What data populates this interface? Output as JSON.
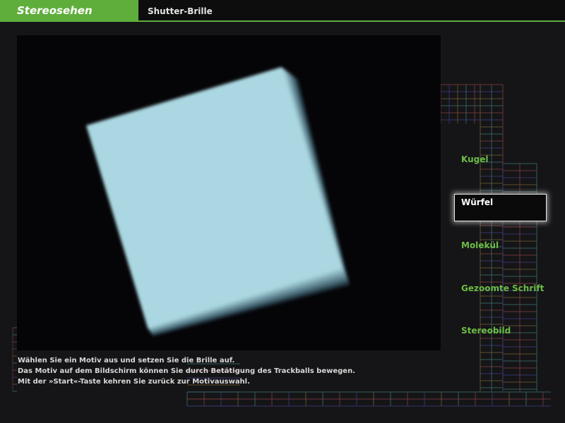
{
  "header": {
    "brand": "Stereosehen",
    "section": "Shutter-Brille"
  },
  "menu": {
    "items": [
      {
        "label": "Kugel",
        "active": false
      },
      {
        "label": "Würfel",
        "active": true
      },
      {
        "label": "Molekül",
        "active": false
      },
      {
        "label": "Gezoomte Schrift",
        "active": false
      },
      {
        "label": "Stereobild",
        "active": false
      }
    ]
  },
  "instructions": [
    "Wählen Sie ein Motiv aus und setzen Sie die Brille auf.",
    "Das Motiv auf dem Bildschirm können Sie durch Betätigung des Trackballs bewegen.",
    "Mit der »Start«-Taste kehren Sie zurück zur Motivauswahl."
  ],
  "colors": {
    "accent_green": "#5fae3c",
    "menu_green": "#6cbc45",
    "background": "#151517",
    "cube_light": "#a9d6e0",
    "cube_dark": "#1a2630"
  }
}
